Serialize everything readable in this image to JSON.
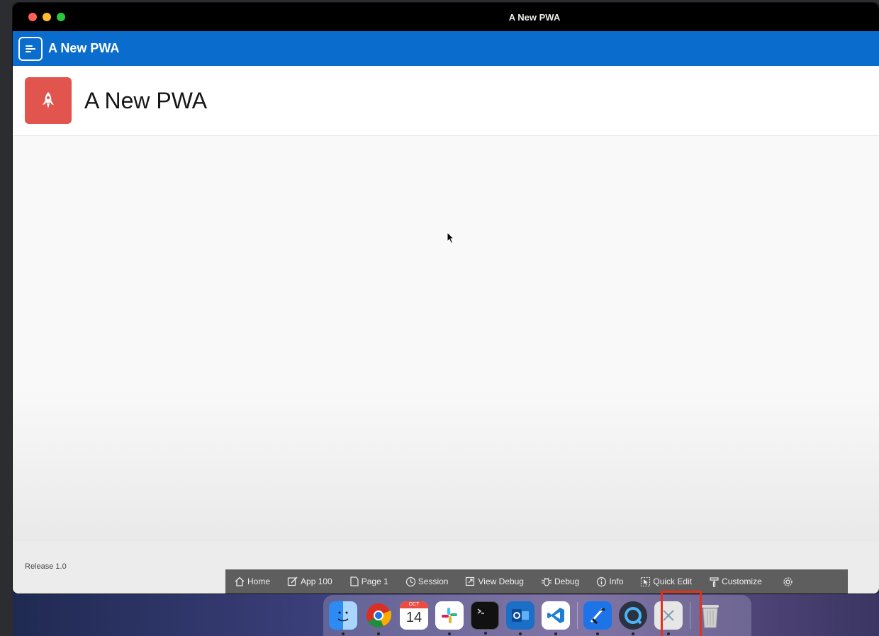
{
  "window": {
    "title": "A New PWA"
  },
  "appbar": {
    "title": "A New PWA"
  },
  "hero": {
    "title": "A New PWA"
  },
  "footer": {
    "release": "Release 1.0"
  },
  "devbar": {
    "items": [
      {
        "label": "Home",
        "icon": "home-icon"
      },
      {
        "label": "App 100",
        "icon": "edit-icon"
      },
      {
        "label": "Page 1",
        "icon": "page-icon"
      },
      {
        "label": "Session",
        "icon": "clock-icon"
      },
      {
        "label": "View Debug",
        "icon": "external-icon"
      },
      {
        "label": "Debug",
        "icon": "bug-icon"
      },
      {
        "label": "Info",
        "icon": "info-icon"
      },
      {
        "label": "Quick Edit",
        "icon": "quick-edit-icon"
      },
      {
        "label": "Customize",
        "icon": "brush-icon"
      }
    ],
    "settings_icon": "gear-icon"
  },
  "dock": {
    "calendar_month": "OCT",
    "calendar_day": "14",
    "apps": [
      "finder",
      "chrome",
      "calendar",
      "slack",
      "terminal",
      "outlook",
      "vscode",
      "xcode",
      "quicktime",
      "pwa-app",
      "trash"
    ]
  },
  "colors": {
    "appbar": "#0a6ccd",
    "app_icon": "#e2554f",
    "devbar": "#5e5e5e",
    "highlight": "#e0321c"
  }
}
